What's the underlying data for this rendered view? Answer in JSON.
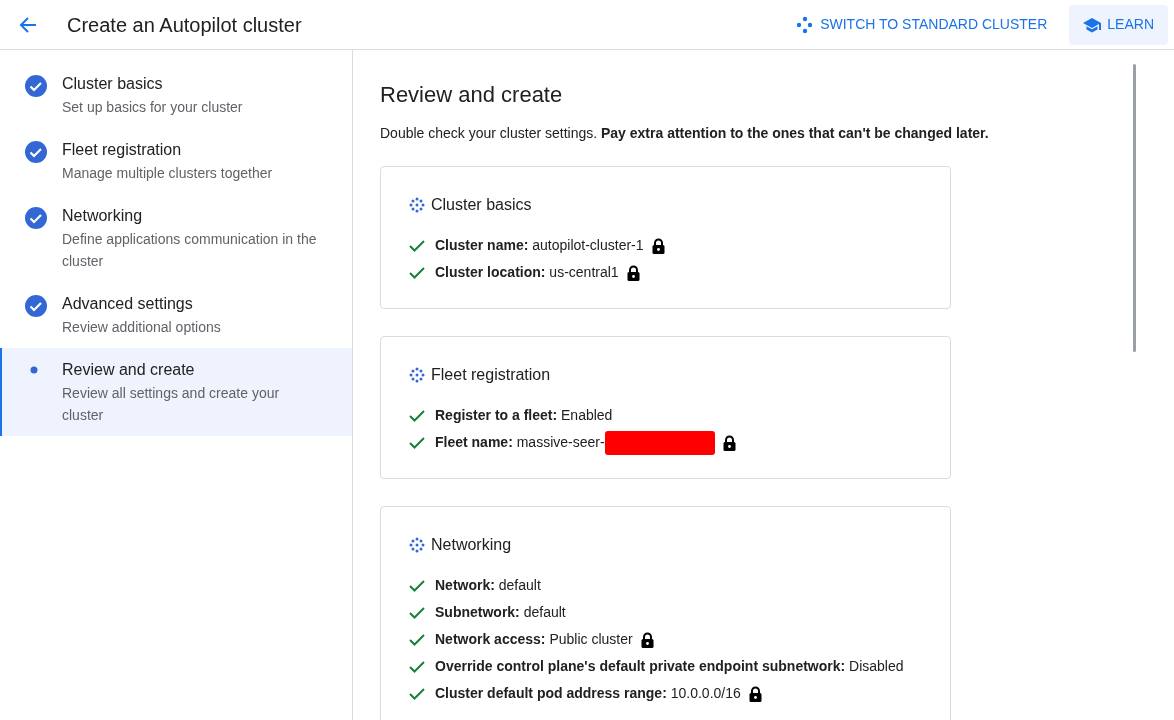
{
  "header": {
    "title": "Create an Autopilot cluster",
    "switch_button": "SWITCH TO STANDARD CLUSTER",
    "learn_button": "LEARN"
  },
  "steps": [
    {
      "title": "Cluster basics",
      "subtitle": "Set up basics for your cluster",
      "completed": true,
      "selected": false
    },
    {
      "title": "Fleet registration",
      "subtitle": "Manage multiple clusters together",
      "completed": true,
      "selected": false
    },
    {
      "title": "Networking",
      "subtitle": "Define applications communication in the cluster",
      "completed": true,
      "selected": false
    },
    {
      "title": "Advanced settings",
      "subtitle": "Review additional options",
      "completed": true,
      "selected": false
    },
    {
      "title": "Review and create",
      "subtitle": "Review all settings and create your cluster",
      "completed": false,
      "selected": true
    }
  ],
  "review": {
    "heading": "Review and create",
    "intro": "Double check your cluster settings. **Pay extra attention to the ones that can't be changed later.**",
    "sections": [
      {
        "title": "Cluster basics",
        "items": [
          {
            "label": "Cluster name:",
            "value": "autopilot-cluster-1",
            "locked": true,
            "redacted": false
          },
          {
            "label": "Cluster location:",
            "value": "us-central1",
            "locked": true,
            "redacted": false
          }
        ]
      },
      {
        "title": "Fleet registration",
        "items": [
          {
            "label": "Register to a fleet:",
            "value": "Enabled",
            "locked": false,
            "redacted": false
          },
          {
            "label": "Fleet name:",
            "value": "massive-seer-",
            "locked": true,
            "redacted": true
          }
        ]
      },
      {
        "title": "Networking",
        "items": [
          {
            "label": "Network:",
            "value": "default",
            "locked": false,
            "redacted": false
          },
          {
            "label": "Subnetwork:",
            "value": "default",
            "locked": false,
            "redacted": false
          },
          {
            "label": "Network access:",
            "value": "Public cluster",
            "locked": true,
            "redacted": false
          },
          {
            "label": "Override control plane's default private endpoint subnetwork:",
            "value": "Disabled",
            "locked": false,
            "redacted": false
          },
          {
            "label": "Cluster default pod address range:",
            "value": "10.0.0.0/16",
            "locked": true,
            "redacted": false
          }
        ]
      }
    ]
  }
}
